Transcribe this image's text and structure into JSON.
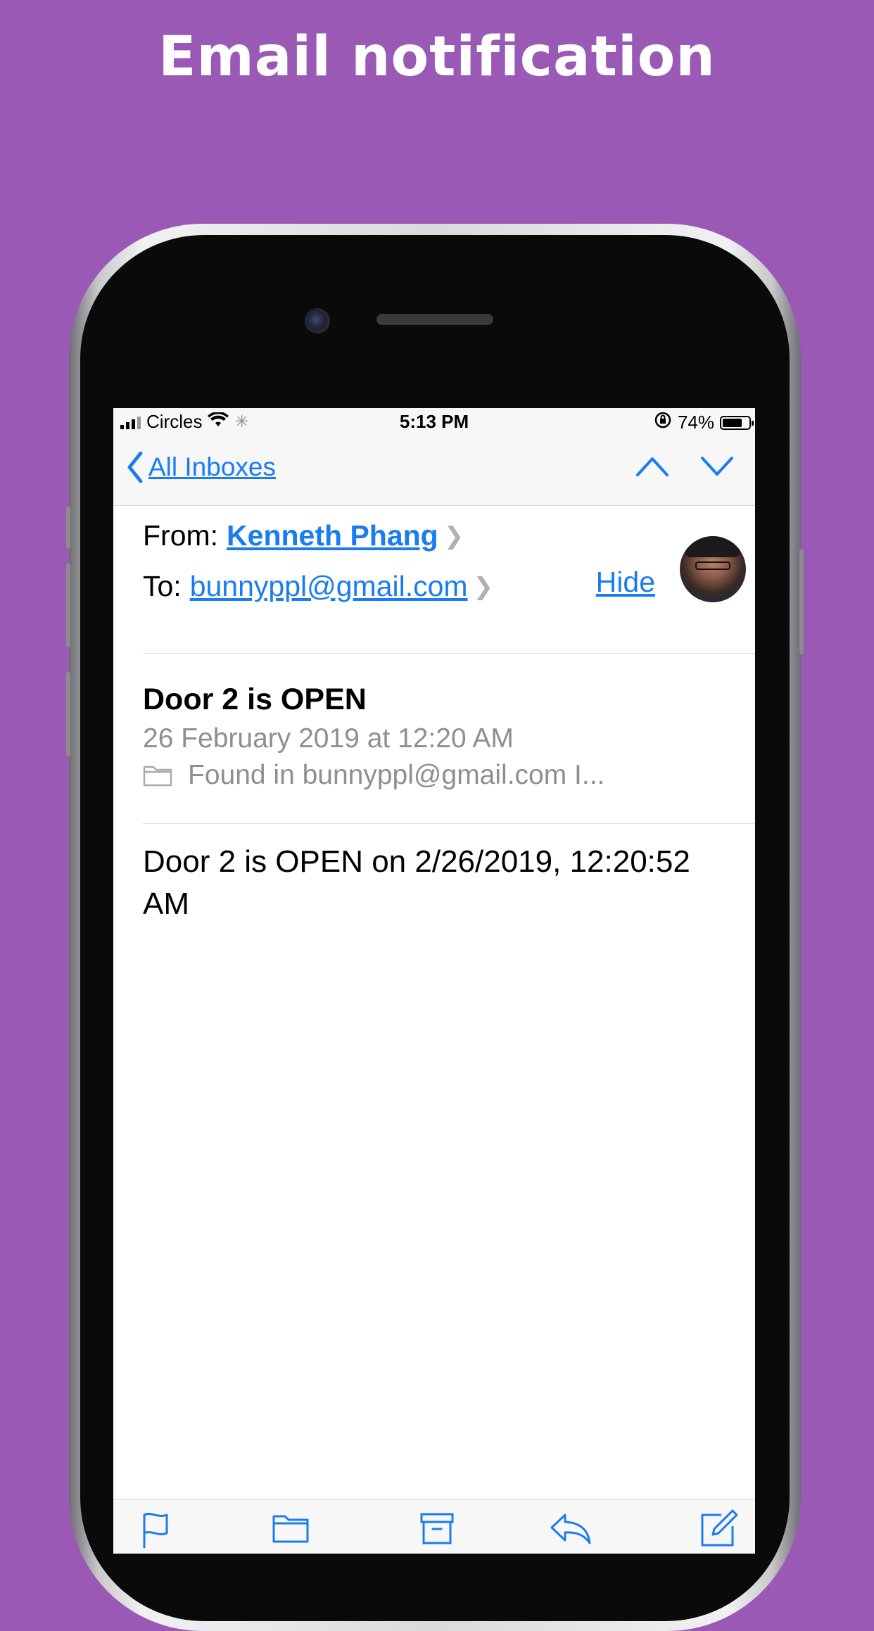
{
  "headline": "Email notification",
  "status_bar": {
    "carrier": "Circles",
    "time": "5:13 PM",
    "battery_percent": "74%",
    "battery_level": 0.74
  },
  "nav": {
    "back_label": "All Inboxes",
    "icons": [
      "chevron-left-icon",
      "chevron-up-icon",
      "chevron-down-icon"
    ]
  },
  "header": {
    "from_label": "From:",
    "from_name": "Kenneth Phang",
    "to_label": "To:",
    "to_address": "bunnyppl@gmail.com",
    "hide_label": "Hide"
  },
  "message": {
    "subject": "Door 2 is OPEN",
    "date": "26 February 2019 at 12:20 AM",
    "found_in": "Found in bunnyppl@gmail.com I...",
    "body": "Door 2 is OPEN on 2/26/2019, 12:20:52 AM"
  },
  "toolbar": {
    "icons": [
      "flag-icon",
      "folder-icon",
      "archive-icon",
      "reply-icon",
      "compose-icon"
    ]
  },
  "colors": {
    "background": "#9a59b5",
    "accent": "#1a7cf0",
    "secondary_text": "#8e8e93"
  }
}
